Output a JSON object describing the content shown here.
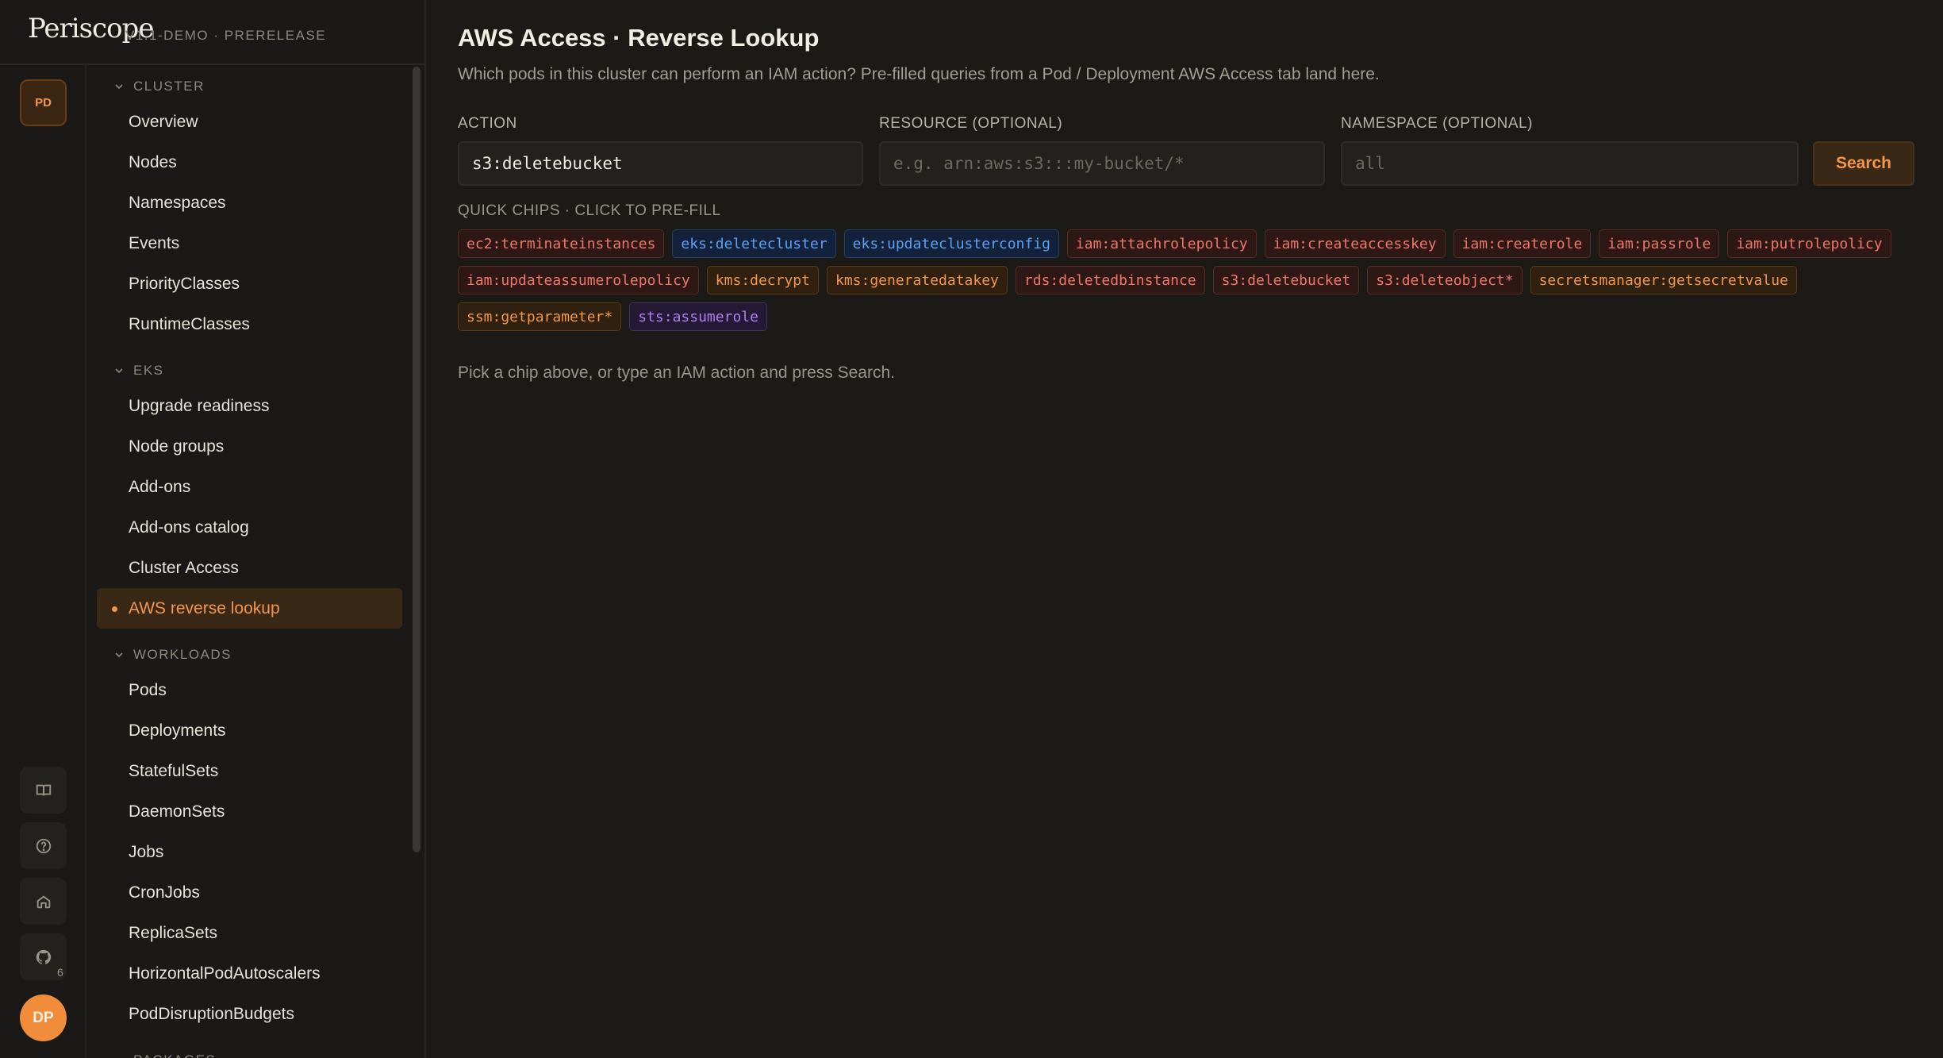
{
  "brand": {
    "logo": "Periscope",
    "version": "V1.1-DEMO · PRERELEASE"
  },
  "rail": {
    "cluster_badge": "PD",
    "github_count": "6",
    "avatar_initials": "DP",
    "icons": [
      "book-icon",
      "help-icon",
      "home-icon",
      "github-icon"
    ]
  },
  "nav": {
    "sections": [
      {
        "title": "CLUSTER",
        "items": [
          "Overview",
          "Nodes",
          "Namespaces",
          "Events",
          "PriorityClasses",
          "RuntimeClasses"
        ]
      },
      {
        "title": "EKS",
        "items": [
          "Upgrade readiness",
          "Node groups",
          "Add-ons",
          "Add-ons catalog",
          "Cluster Access",
          "AWS reverse lookup"
        ]
      },
      {
        "title": "WORKLOADS",
        "items": [
          "Pods",
          "Deployments",
          "StatefulSets",
          "DaemonSets",
          "Jobs",
          "CronJobs",
          "ReplicaSets",
          "HorizontalPodAutoscalers",
          "PodDisruptionBudgets"
        ]
      },
      {
        "title": "PACKAGES",
        "items": []
      }
    ],
    "active_item": "AWS reverse lookup"
  },
  "main": {
    "title": "AWS Access · Reverse Lookup",
    "subtitle": "Which pods in this cluster can perform an IAM action? Pre-filled queries from a Pod / Deployment AWS Access tab land here.",
    "action": {
      "label": "ACTION",
      "value": "s3:deletebucket"
    },
    "resource": {
      "label": "RESOURCE (OPTIONAL)",
      "placeholder": "e.g. arn:aws:s3:::my-bucket/*"
    },
    "namespace": {
      "label": "NAMESPACE (OPTIONAL)",
      "placeholder": "all"
    },
    "search_label": "Search",
    "chips_label": "QUICK CHIPS · CLICK TO PRE-FILL",
    "chips": [
      {
        "text": "ec2:terminateinstances",
        "color": "red"
      },
      {
        "text": "eks:deletecluster",
        "color": "blue"
      },
      {
        "text": "eks:updateclusterconfig",
        "color": "blue"
      },
      {
        "text": "iam:attachrolepolicy",
        "color": "red"
      },
      {
        "text": "iam:createaccesskey",
        "color": "red"
      },
      {
        "text": "iam:createrole",
        "color": "red"
      },
      {
        "text": "iam:passrole",
        "color": "red"
      },
      {
        "text": "iam:putrolepolicy",
        "color": "red"
      },
      {
        "text": "iam:updateassumerolepolicy",
        "color": "red"
      },
      {
        "text": "kms:decrypt",
        "color": "orange"
      },
      {
        "text": "kms:generatedatakey",
        "color": "orange"
      },
      {
        "text": "rds:deletedbinstance",
        "color": "red"
      },
      {
        "text": "s3:deletebucket",
        "color": "red"
      },
      {
        "text": "s3:deleteobject*",
        "color": "red"
      },
      {
        "text": "secretsmanager:getsecretvalue",
        "color": "orange"
      },
      {
        "text": "ssm:getparameter*",
        "color": "orange"
      },
      {
        "text": "sts:assumerole",
        "color": "purple"
      }
    ],
    "hint": "Pick a chip above, or type an IAM action and press Search."
  },
  "colors": {
    "accent": "#f2974a",
    "background": "#1b1a17",
    "chip_red": "#f07767",
    "chip_blue": "#5aa2f5",
    "chip_orange": "#f2974a",
    "chip_purple": "#b07ff0"
  }
}
